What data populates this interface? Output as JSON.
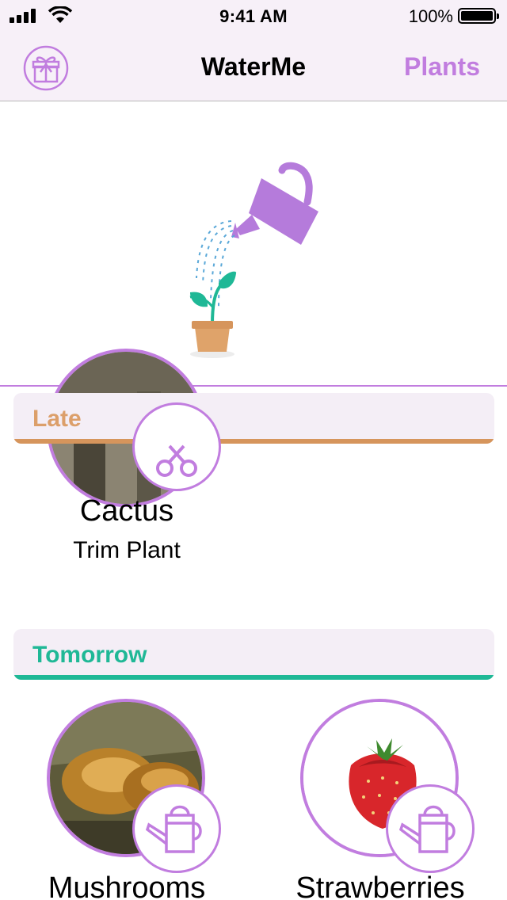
{
  "status_bar": {
    "time": "9:41 AM",
    "battery_percent": "100%"
  },
  "nav": {
    "title": "WaterMe",
    "right_button": "Plants",
    "left_icon": "gift-icon"
  },
  "sections": [
    {
      "title": "Late",
      "color": "#d6955c",
      "plants": [
        {
          "name": "Cactus",
          "task": "Trim Plant",
          "badge_icon": "scissors-icon"
        }
      ]
    },
    {
      "title": "Tomorrow",
      "color": "#1fb896",
      "plants": [
        {
          "name": "Mushrooms",
          "badge_icon": "watering-can-icon"
        },
        {
          "name": "Strawberries",
          "badge_icon": "watering-can-icon"
        }
      ]
    }
  ],
  "accent_color": "#c17ddf"
}
